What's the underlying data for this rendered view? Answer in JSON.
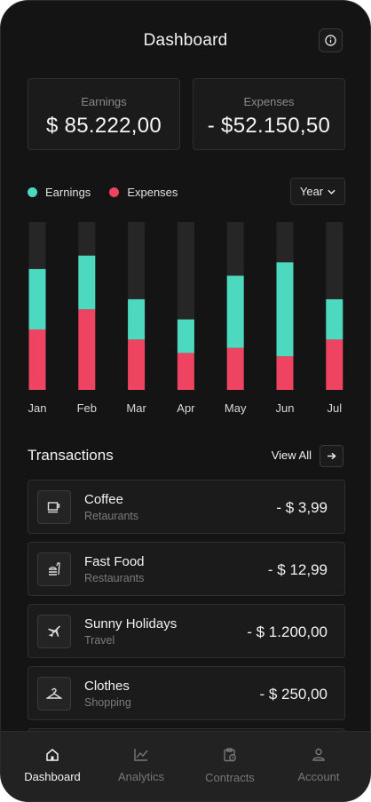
{
  "header": {
    "title": "Dashboard",
    "info_icon": "info-icon"
  },
  "stats": {
    "earnings": {
      "label": "Earnings",
      "value": "$ 85.222,00"
    },
    "expenses": {
      "label": "Expenses",
      "value": "- $52.150,50"
    }
  },
  "legend": {
    "earnings_label": "Earnings",
    "expenses_label": "Expenses"
  },
  "period_select": {
    "selected": "Year",
    "icon": "chevron-down-icon"
  },
  "colors": {
    "earnings": "#4dd9bf",
    "expenses": "#ee4361",
    "track": "#262626"
  },
  "chart_data": {
    "type": "bar",
    "stacked": true,
    "categories": [
      "Jan",
      "Feb",
      "Mar",
      "Apr",
      "May",
      "Jun",
      "Jul"
    ],
    "series": [
      {
        "name": "Expenses",
        "values": [
          36,
          48,
          30,
          22,
          25,
          20,
          30
        ]
      },
      {
        "name": "Earnings",
        "values": [
          36,
          32,
          24,
          20,
          43,
          56,
          24
        ]
      }
    ],
    "ylim": [
      0,
      100
    ],
    "grid": false,
    "legend": "top-left"
  },
  "transactions": {
    "title": "Transactions",
    "view_all": "View All",
    "arrow_icon": "arrow-right-icon",
    "items": [
      {
        "name": "Coffee",
        "category": "Retaurants",
        "amount": "- $ 3,99",
        "icon": "coffee-icon"
      },
      {
        "name": "Fast Food",
        "category": "Restaurants",
        "amount": "- $ 12,99",
        "icon": "fast-food-icon"
      },
      {
        "name": "Sunny Holidays",
        "category": "Travel",
        "amount": "- $ 1.200,00",
        "icon": "airplane-icon"
      },
      {
        "name": "Clothes",
        "category": "Shopping",
        "amount": "- $ 250,00",
        "icon": "hanger-icon"
      }
    ]
  },
  "nav": {
    "items": [
      {
        "label": "Dashboard",
        "icon": "home-icon",
        "active": true
      },
      {
        "label": "Analytics",
        "icon": "analytics-icon",
        "active": false
      },
      {
        "label": "Contracts",
        "icon": "contracts-icon",
        "active": false
      },
      {
        "label": "Account",
        "icon": "user-icon",
        "active": false
      }
    ]
  }
}
